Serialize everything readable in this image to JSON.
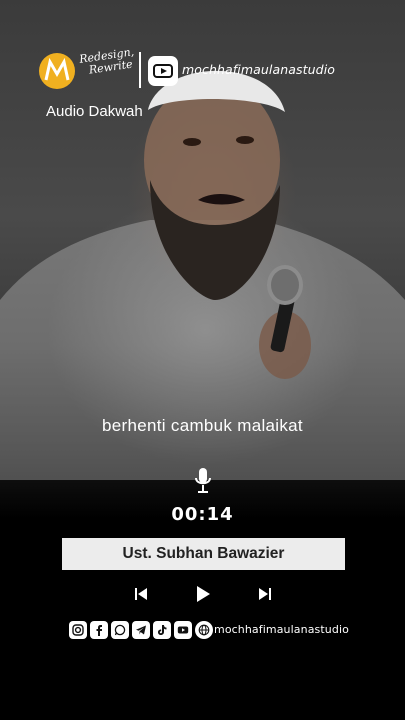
{
  "header": {
    "brand_line1": "Redesign,",
    "brand_line2": "Rewrite",
    "channel": "mochhafimaulanastudio"
  },
  "label": "Audio Dakwah",
  "caption": "berhenti cambuk malaikat",
  "player": {
    "time": "00:14",
    "speaker": "Ust. Subhan Bawazier"
  },
  "footer": {
    "channel": "mochhafimaulanastudio",
    "icons": [
      "instagram-icon",
      "facebook-icon",
      "whatsapp-icon",
      "telegram-icon",
      "tiktok-icon",
      "youtube-icon",
      "web-icon"
    ]
  }
}
